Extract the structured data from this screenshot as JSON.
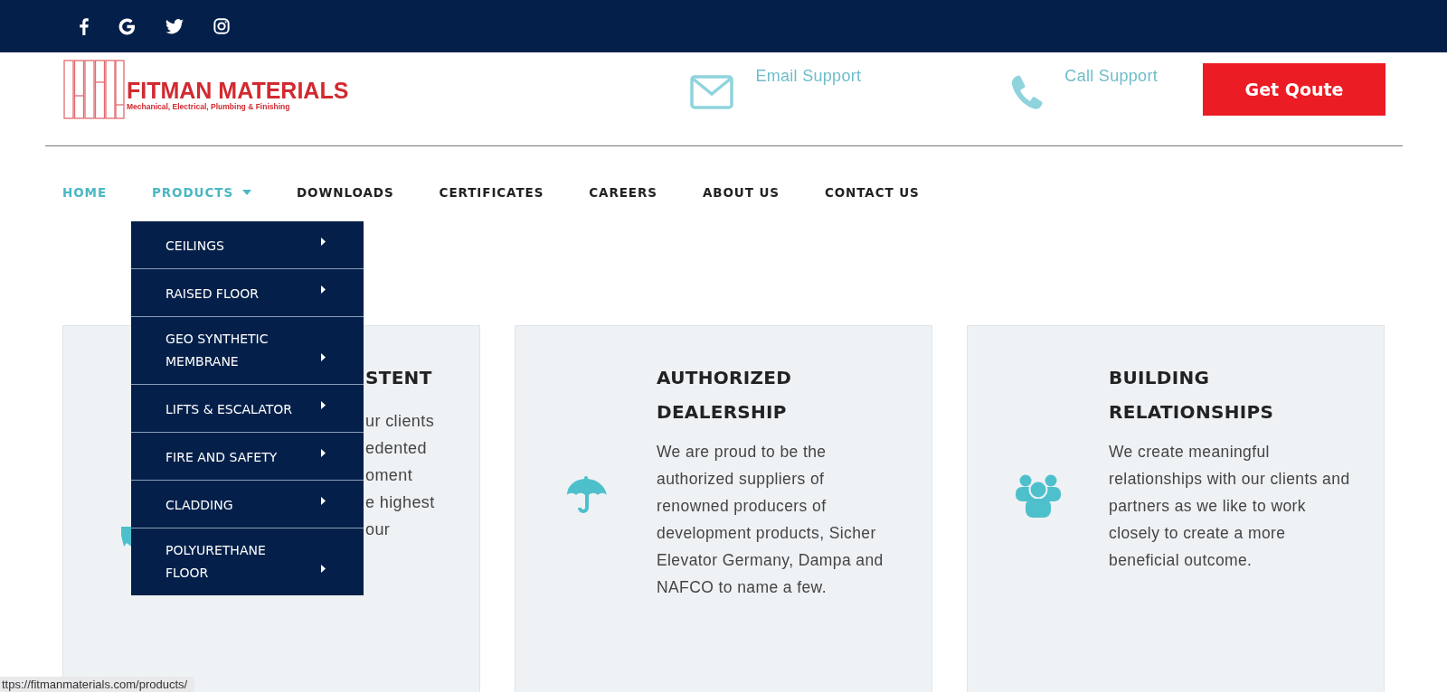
{
  "social": [
    {
      "kind": "facebook"
    },
    {
      "kind": "google"
    },
    {
      "kind": "twitter"
    },
    {
      "kind": "instagram"
    }
  ],
  "logo": {
    "title": "FITMAN MATERIALS",
    "tagline": "Mechanical, Electrical, Plumbing & Finishing"
  },
  "contacts": [
    {
      "kind": "email",
      "label": "Email Support"
    },
    {
      "kind": "phone",
      "label": "Call Support"
    }
  ],
  "quote_button": "Get Qoute",
  "nav": [
    {
      "label": "HOME",
      "highlighted": true,
      "submenu": false
    },
    {
      "label": "PRODUCTS",
      "highlighted": true,
      "submenu": true,
      "expanded": true
    },
    {
      "label": "DOWNLOADS",
      "highlighted": false,
      "submenu": false
    },
    {
      "label": "CERTIFICATES",
      "highlighted": false,
      "submenu": false
    },
    {
      "label": "CAREERS",
      "highlighted": false,
      "submenu": false
    },
    {
      "label": "ABOUT US",
      "highlighted": false,
      "submenu": false
    },
    {
      "label": "CONTACT US",
      "highlighted": false,
      "submenu": false
    }
  ],
  "dropdown": [
    {
      "label": "CEILINGS",
      "submenu": true
    },
    {
      "label": "RAISED FLOOR",
      "submenu": true
    },
    {
      "label": "GEO SYNTHETIC MEMBRANE",
      "submenu": true
    },
    {
      "label": "LIFTS & ESCALATOR",
      "submenu": true
    },
    {
      "label": "FIRE AND SAFETY",
      "submenu": true
    },
    {
      "label": "CLADDING",
      "submenu": true
    },
    {
      "label": "POLYURETHANE FLOOR",
      "submenu": true
    }
  ],
  "cards": [
    {
      "title": "STENT",
      "lines": [
        "ur clients",
        "edented",
        "oment",
        "e highest",
        "our"
      ]
    },
    {
      "title": "AUTHORIZED DEALERSHIP",
      "text": "We are proud to be the authorized suppliers of renowned producers of development products, Sicher Elevator Germany, Dampa and NAFCO to name a few."
    },
    {
      "title": "BUILDING RELATIONSHIPS",
      "text": "We create meaningful relationships with our clients and partners as we like to work closely to create a more beneficial outcome."
    }
  ],
  "status_url": "ttps://fitmanmaterials.com/products/"
}
